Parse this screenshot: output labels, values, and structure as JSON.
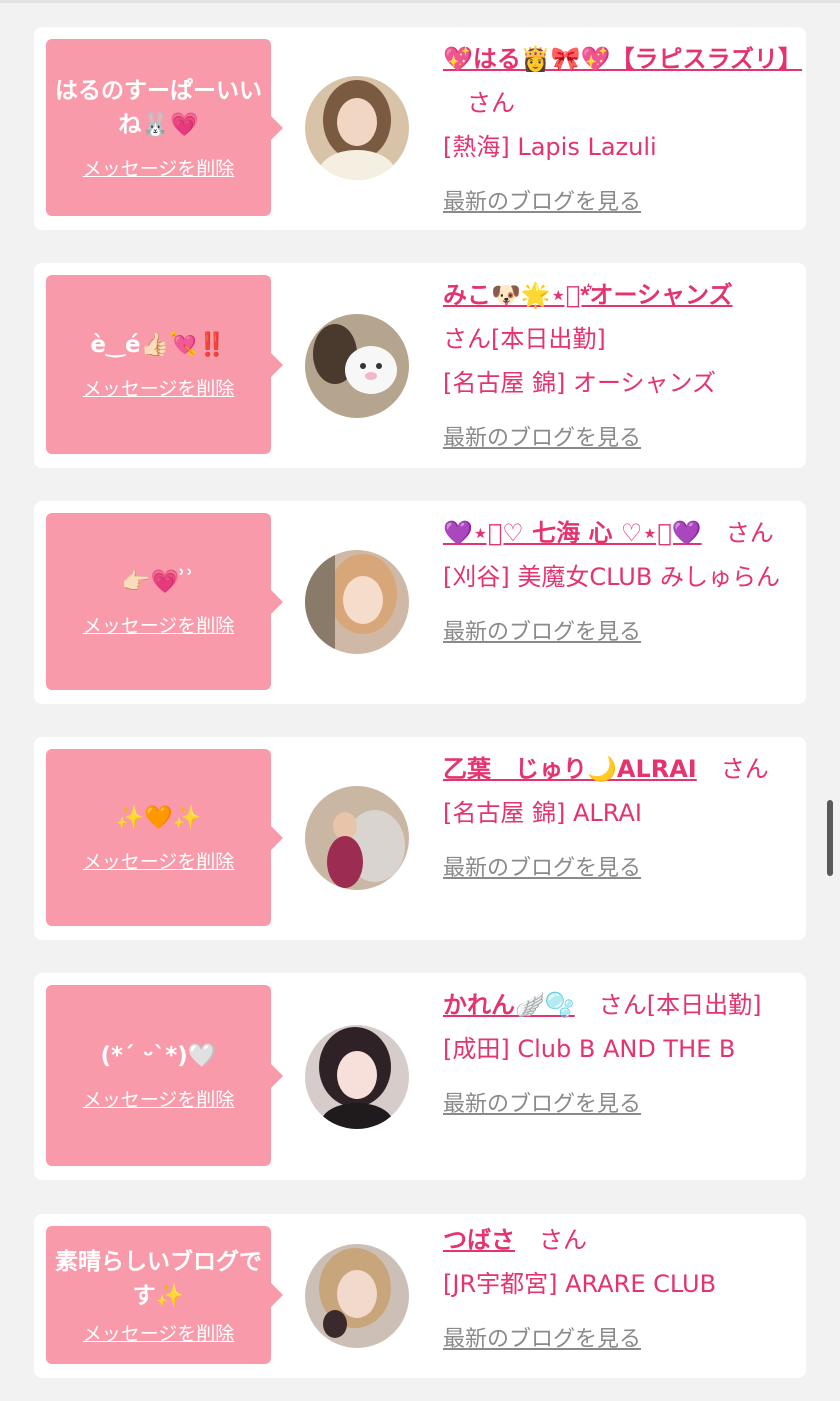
{
  "messages": [
    {
      "comment": "はるのすーぱーいいね🐰💗",
      "delete_label": "メッセージを削除",
      "name": "💖はる👸🎀💖【ラピスラズリ】",
      "suffix": "さん",
      "shop": "[熱海] Lapis Lazuli",
      "blog_label": "最新のブログを見る",
      "avatar_color": "#d8c2a8"
    },
    {
      "comment": "è‿é👍🏻💘‼️",
      "delete_label": "メッセージを削除",
      "name": "みこ🐶🌟⋆͛*͛オーシャンズ",
      "suffix": "さん[本日出勤]",
      "shop": "[名古屋 錦] オーシャンズ",
      "blog_label": "最新のブログを見る",
      "avatar_color": "#b6a58e"
    },
    {
      "comment": "👉🏻💗 ͗ ͗",
      "delete_label": "メッセージを削除",
      "name": "💜⋆͛♡ 七海 心 ♡⋆͛💜",
      "suffix": "さん",
      "shop": "[刈谷] 美魔女CLUB みしゅらん",
      "blog_label": "最新のブログを見る",
      "avatar_color": "#cfb8a6"
    },
    {
      "comment": "✨🧡✨",
      "delete_label": "メッセージを削除",
      "name": "乙葉　じゅり🌙ALRAI",
      "suffix": "さん",
      "shop": "[名古屋 錦] ALRAI",
      "blog_label": "最新のブログを見る",
      "avatar_color": "#c9b7a3"
    },
    {
      "comment": "(*ˊ ᵕˋ*)🤍",
      "delete_label": "メッセージを削除",
      "name": "かれん🪽🫧",
      "suffix": "さん[本日出勤]",
      "shop": "[成田] Club B AND THE B",
      "blog_label": "最新のブログを見る",
      "avatar_color": "#d6cdca"
    },
    {
      "comment": "素晴らしいブログです✨",
      "delete_label": "メッセージを削除",
      "name": "つばさ",
      "suffix": "さん",
      "shop": "[JR宇都宮] ARARE CLUB",
      "blog_label": "最新のブログを見る",
      "avatar_color": "#cbbfb6"
    }
  ]
}
